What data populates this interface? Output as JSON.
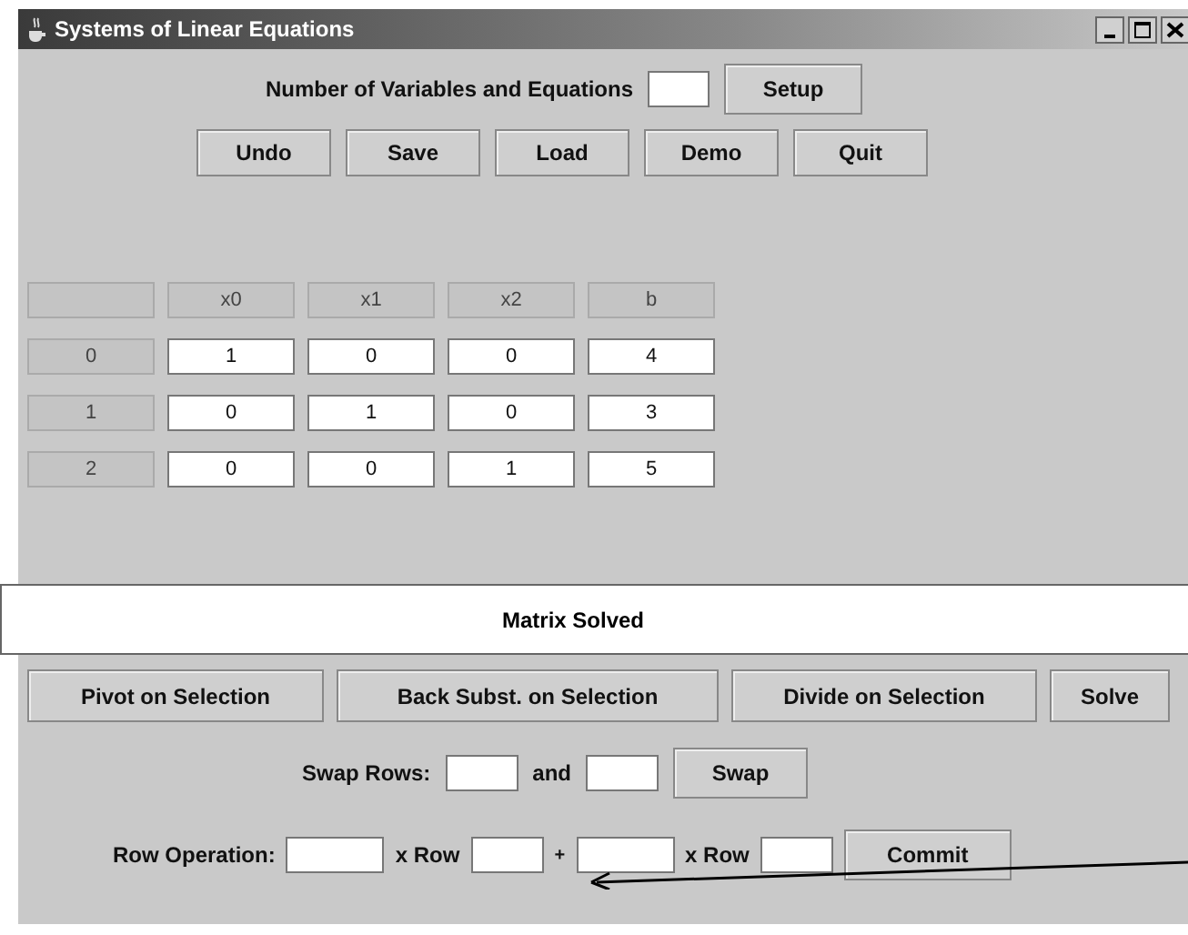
{
  "window": {
    "title": "Systems of Linear Equations"
  },
  "setup": {
    "label": "Number of Variables and Equations",
    "button": "Setup"
  },
  "toolbar": [
    "Undo",
    "Save",
    "Load",
    "Demo",
    "Quit"
  ],
  "matrix": {
    "columns": [
      "x0",
      "x1",
      "x2",
      "b"
    ],
    "rows": [
      {
        "label": "0",
        "cells": [
          "1",
          "0",
          "0",
          "4"
        ]
      },
      {
        "label": "1",
        "cells": [
          "0",
          "1",
          "0",
          "3"
        ]
      },
      {
        "label": "2",
        "cells": [
          "0",
          "0",
          "1",
          "5"
        ]
      }
    ]
  },
  "status": "Matrix Solved",
  "actions": [
    "Pivot on Selection",
    "Back Subst. on Selection",
    "Divide on Selection",
    "Solve"
  ],
  "swap": {
    "label": "Swap Rows:",
    "and": "and",
    "button": "Swap"
  },
  "row_operation": {
    "label": "Row Operation:",
    "times_1": "x Row",
    "plus": "+",
    "times_2": "x Row",
    "button": "Commit"
  }
}
